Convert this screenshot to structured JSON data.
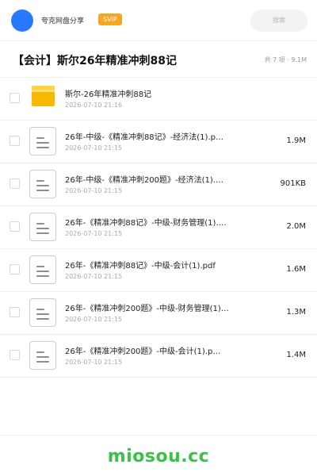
{
  "topbar": {
    "app_title": "夸克网盘分享",
    "vip_badge": "SVIP",
    "search_placeholder": "搜索"
  },
  "header": {
    "title": "【会计】斯尔26年精准冲刺88记",
    "summary": "共 7 项 · 9.1M"
  },
  "files": [
    {
      "name": "斯尔-26年精准冲刺88记",
      "date": "2026-07-10 21:16",
      "size": "",
      "type": "folder"
    },
    {
      "name": "26年-中级-《精准冲刺88记》-经济法(1).p…",
      "date": "2026-07-10 21:15",
      "size": "1.9M",
      "type": "file"
    },
    {
      "name": "26年-中级-《精准冲刺200题》-经济法(1).…",
      "date": "2026-07-10 21:15",
      "size": "901KB",
      "type": "file"
    },
    {
      "name": "26年-《精准冲刺88记》-中级-财务管理(1).…",
      "date": "2026-07-10 21:15",
      "size": "2.0M",
      "type": "file"
    },
    {
      "name": "26年-《精准冲刺88记》-中级-会计(1).pdf",
      "date": "2026-07-10 21:15",
      "size": "1.6M",
      "type": "file"
    },
    {
      "name": "26年-《精准冲刺200题》-中级-财务管理(1)…",
      "date": "2026-07-10 21:15",
      "size": "1.3M",
      "type": "file"
    },
    {
      "name": "26年-《精准冲刺200题》-中级-会计(1).p…",
      "date": "2026-07-10 21:15",
      "size": "1.4M",
      "type": "file"
    }
  ],
  "footer": {
    "watermark": "miosou.cc"
  },
  "colors": {
    "brand_blue": "#2979ff",
    "vip_orange": "#f5a623",
    "folder_yellow": "#f9b800",
    "watermark_green": "#3cc04a"
  }
}
